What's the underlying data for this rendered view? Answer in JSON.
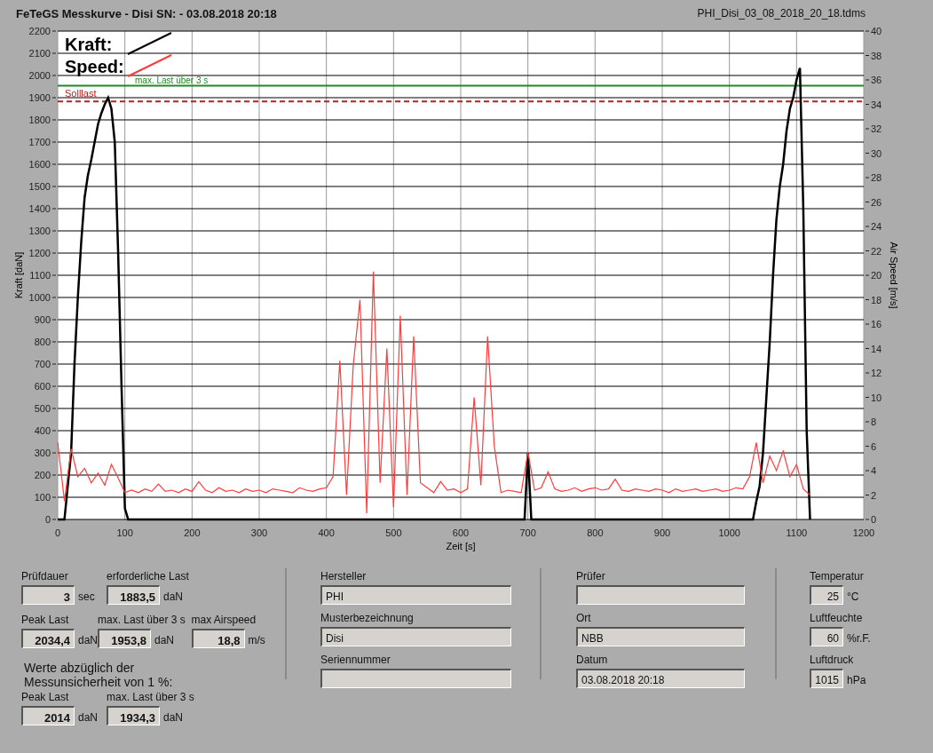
{
  "header": {
    "title": "FeTeGS Messkurve - Disi  SN:  - 03.08.2018 20:18",
    "file": "PHI_Disi_03_08_2018_20_18.tdms"
  },
  "chart": {
    "chart_data": {
      "type": "line",
      "xlabel": "Zeit [s]",
      "ylabel": "Kraft [daN]",
      "y2label": "Air Speed [m/s]",
      "xlim": [
        0,
        1200
      ],
      "ylim": [
        0,
        2200
      ],
      "y2lim": [
        0,
        40
      ],
      "xticks": [
        0,
        100,
        200,
        300,
        400,
        500,
        600,
        700,
        800,
        900,
        1000,
        1100,
        1200
      ],
      "yticks": [
        0,
        100,
        200,
        300,
        400,
        500,
        600,
        700,
        800,
        900,
        1000,
        1100,
        1200,
        1300,
        1400,
        1500,
        1600,
        1700,
        1800,
        1900,
        2000,
        2100,
        2200
      ],
      "y2ticks": [
        0,
        2,
        4,
        6,
        8,
        10,
        12,
        14,
        16,
        18,
        20,
        22,
        24,
        26,
        28,
        30,
        32,
        34,
        36,
        38,
        40
      ],
      "series": [
        {
          "name": "Kraft:",
          "color": "#000000",
          "x": [
            0,
            10,
            15,
            20,
            25,
            30,
            35,
            40,
            45,
            50,
            55,
            60,
            65,
            70,
            75,
            80,
            85,
            90,
            95,
            100,
            105,
            200,
            300,
            400,
            500,
            600,
            695,
            700,
            705,
            800,
            900,
            1000,
            1035,
            1040,
            1045,
            1050,
            1055,
            1060,
            1065,
            1070,
            1075,
            1080,
            1085,
            1090,
            1095,
            1100,
            1105,
            1110,
            1115,
            1120
          ],
          "values": [
            0,
            0,
            150,
            300,
            700,
            1000,
            1250,
            1450,
            1550,
            1620,
            1700,
            1780,
            1830,
            1870,
            1900,
            1850,
            1700,
            1200,
            600,
            50,
            0,
            0,
            0,
            0,
            0,
            0,
            0,
            300,
            0,
            0,
            0,
            0,
            0,
            80,
            150,
            300,
            550,
            800,
            1100,
            1350,
            1500,
            1600,
            1750,
            1850,
            1900,
            1980,
            2034,
            1400,
            400,
            0
          ]
        },
        {
          "name": "Speed:",
          "color": "#ff3b3b",
          "axis": "y2",
          "x": [
            0,
            10,
            20,
            30,
            40,
            50,
            60,
            70,
            80,
            90,
            100,
            110,
            120,
            130,
            140,
            150,
            160,
            170,
            180,
            190,
            200,
            210,
            220,
            230,
            240,
            250,
            260,
            270,
            280,
            290,
            300,
            310,
            320,
            330,
            340,
            350,
            360,
            370,
            380,
            390,
            400,
            410,
            420,
            430,
            440,
            450,
            460,
            470,
            480,
            490,
            500,
            510,
            520,
            530,
            540,
            550,
            560,
            570,
            580,
            590,
            600,
            610,
            620,
            630,
            640,
            650,
            660,
            670,
            680,
            690,
            700,
            710,
            720,
            730,
            740,
            750,
            760,
            770,
            780,
            790,
            800,
            810,
            820,
            830,
            840,
            850,
            860,
            870,
            880,
            890,
            900,
            910,
            920,
            930,
            940,
            950,
            960,
            970,
            980,
            990,
            1000,
            1010,
            1020,
            1030,
            1040,
            1050,
            1060,
            1070,
            1080,
            1090,
            1100,
            1110,
            1120
          ],
          "values": [
            6.3,
            1.5,
            5.8,
            3.5,
            4.2,
            3.0,
            3.8,
            2.8,
            4.5,
            3.4,
            2.2,
            2.4,
            2.2,
            2.5,
            2.3,
            2.9,
            2.3,
            2.4,
            2.2,
            2.5,
            2.3,
            3.1,
            2.4,
            2.2,
            2.6,
            2.3,
            2.4,
            2.2,
            2.5,
            2.3,
            2.4,
            2.2,
            2.5,
            2.4,
            2.3,
            2.2,
            2.6,
            2.4,
            2.3,
            2.5,
            2.6,
            3.5,
            13,
            2,
            12.6,
            18,
            0.5,
            20.3,
            3,
            14,
            1,
            16.7,
            2,
            15,
            3,
            2.6,
            2.2,
            3.1,
            2.4,
            2.5,
            2.2,
            2.5,
            10,
            2.8,
            15,
            6,
            2.2,
            2.4,
            2.3,
            2.2,
            5.5,
            2.4,
            2.6,
            3.9,
            2.5,
            2.3,
            2.4,
            2.6,
            2.3,
            2.5,
            2.6,
            2.4,
            2.5,
            3.3,
            2.4,
            2.3,
            2.5,
            2.4,
            2.3,
            2.5,
            2.4,
            2.2,
            2.5,
            2.3,
            2.4,
            2.5,
            2.3,
            2.4,
            2.5,
            2.3,
            2.4,
            2.6,
            2.5,
            3.5,
            6.3,
            3.0,
            5.2,
            4,
            5.6,
            3.5,
            4.5,
            2.5,
            2
          ]
        }
      ],
      "grid": true,
      "legend": "upper left",
      "ref_lines": [
        {
          "axis": "y",
          "value": 1953.8,
          "label": "max. Last über  3 s",
          "color": "#1f8a1f"
        },
        {
          "axis": "y",
          "value": 1883.5,
          "label": "Solllast",
          "color": "#b22222"
        }
      ]
    }
  },
  "results": {
    "rows": [
      [
        {
          "label": "Prüfdauer",
          "value": "3",
          "unit": "sec"
        },
        {
          "label": "erforderliche Last",
          "value": "1883,5",
          "unit": "daN"
        }
      ],
      [
        {
          "label": "Peak Last",
          "value": "2034,4",
          "unit": "daN"
        },
        {
          "label": "max. Last über  3 s",
          "value": "1953,8",
          "unit": "daN"
        },
        {
          "label": "max Airspeed",
          "value": "18,8",
          "unit": "m/s"
        }
      ]
    ],
    "note_lines": [
      "Werte abzüglich der",
      "Messunsicherheit von 1  %:"
    ],
    "corrected": [
      {
        "label": "Peak Last",
        "value": "2014",
        "unit": "daN"
      },
      {
        "label": "max. Last über  3 s",
        "value": "1934,3",
        "unit": "daN"
      }
    ]
  },
  "info": {
    "columns": [
      [
        {
          "label": "Hersteller",
          "value": "PHI"
        },
        {
          "label": "Musterbezeichnung",
          "value": "Disi"
        },
        {
          "label": "Seriennummer"
        }
      ],
      [
        {
          "label": "Prüfer"
        },
        {
          "label": "Ort",
          "value": "NBB"
        },
        {
          "label": "Datum",
          "value": "03.08.2018 20:18"
        }
      ]
    ]
  },
  "ambient": [
    {
      "label": "Temperatur",
      "value": "25",
      "unit": "°C"
    },
    {
      "label": "Luftfeuchte",
      "value": "60",
      "unit": "%r.F."
    },
    {
      "label": "Luftdruck",
      "value": "1015",
      "unit": "hPa"
    }
  ]
}
